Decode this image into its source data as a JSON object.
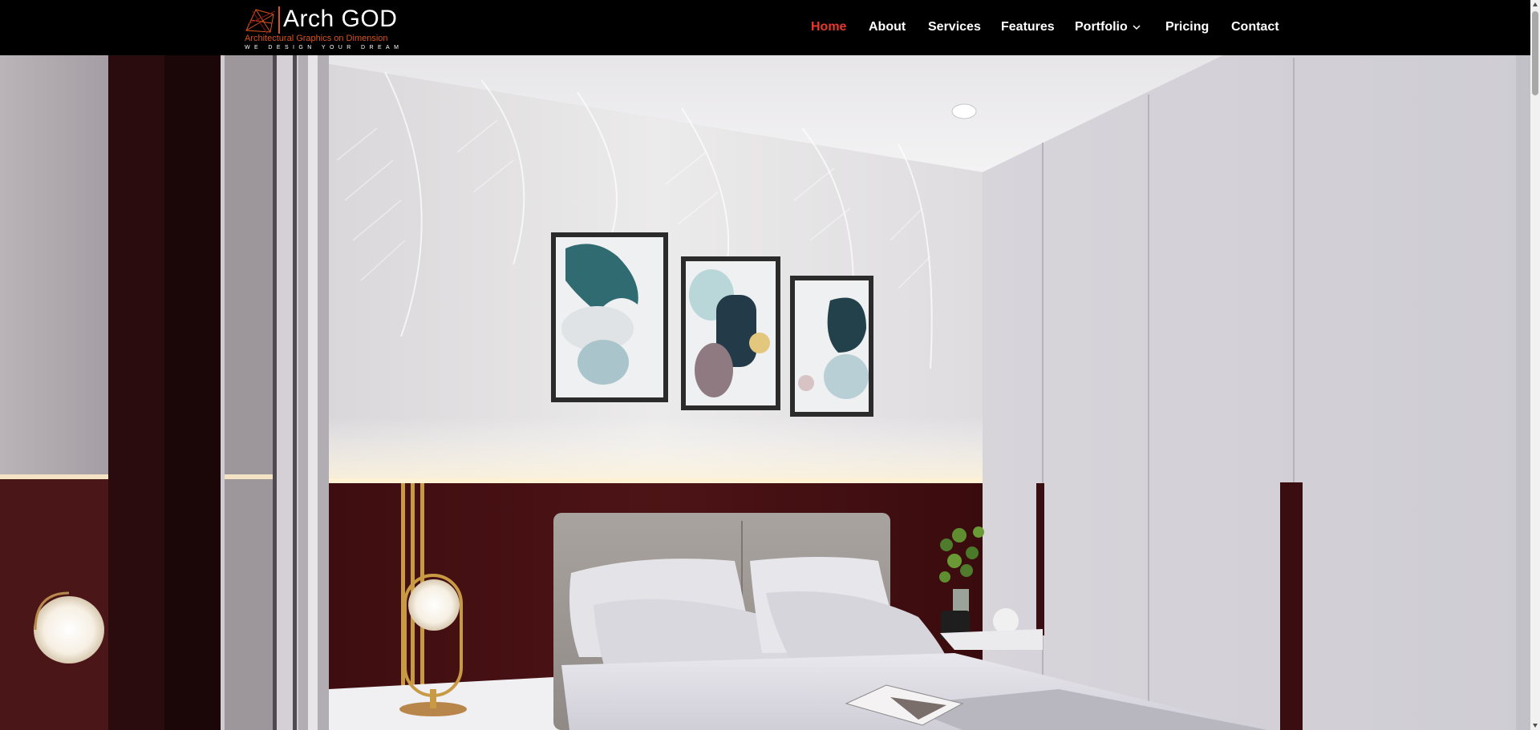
{
  "brand": {
    "title": "Arch GOD",
    "subtitle": "Architectural Graphics on Dimension",
    "tagline": "WE DESIGN YOUR DREAM"
  },
  "nav": {
    "items": [
      {
        "label": "Home",
        "active": true
      },
      {
        "label": "About"
      },
      {
        "label": "Services"
      },
      {
        "label": "Features"
      },
      {
        "label": "Portfolio",
        "has_dropdown": true
      },
      {
        "label": "Pricing"
      },
      {
        "label": "Contact"
      }
    ]
  },
  "colors": {
    "header_bg": "#000000",
    "nav_text": "#ffffff",
    "nav_active": "#e8372d",
    "brand_accent": "#d9531e"
  },
  "icons": {
    "logo_mark": "logo-mark-icon",
    "dropdown": "chevron-down-icon",
    "scroll_up": "arrow-up-icon",
    "scroll_down": "arrow-down-icon"
  },
  "hero": {
    "image": "bedroom-interior-render"
  }
}
